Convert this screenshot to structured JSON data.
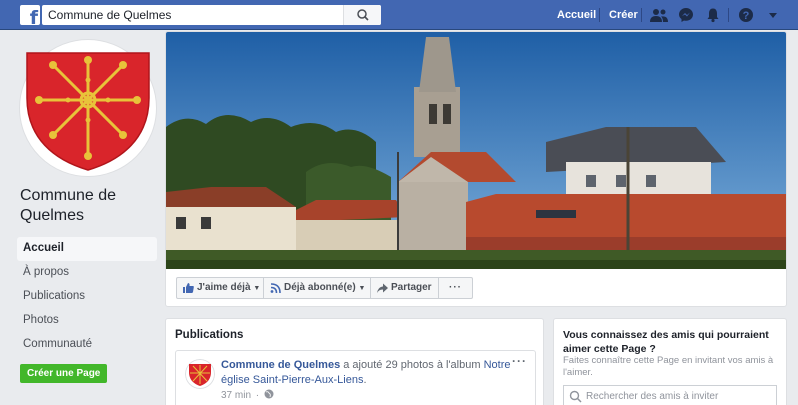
{
  "topbar": {
    "logo": "f",
    "search_value": "Commune de Quelmes",
    "links": {
      "home": "Accueil",
      "create": "Créer"
    },
    "icons": [
      "friends-icon",
      "messenger-icon",
      "notifications-icon",
      "help-icon",
      "account-menu-icon"
    ]
  },
  "page": {
    "name": "Commune de Quelmes",
    "nav": [
      "Accueil",
      "À propos",
      "Publications",
      "Photos",
      "Communauté"
    ],
    "create_page_label": "Créer une Page"
  },
  "actions": {
    "like": "J'aime déjà",
    "follow": "Déjà abonné(e)",
    "share": "Partager",
    "more": "···"
  },
  "publications": {
    "title": "Publications",
    "post": {
      "author": "Commune de Quelmes",
      "action": " a ajouté 29 photos à l'album ",
      "album": "Notre église Saint-Pierre-Aux-Liens",
      "after": ".",
      "time": "37 min",
      "privacy_icon": "globe-icon",
      "menu": "···"
    }
  },
  "suggest": {
    "title": "Vous connaissez des amis qui pourraient aimer cette Page ?",
    "description": "Faites connaître cette Page en invitant vos amis à l'aimer.",
    "search_placeholder": "Rechercher des amis à inviter"
  },
  "colors": {
    "brand": "#4267b2",
    "link": "#365899",
    "green": "#42b72a",
    "shield_red": "#d9252b",
    "shield_gold": "#e8c33a"
  }
}
